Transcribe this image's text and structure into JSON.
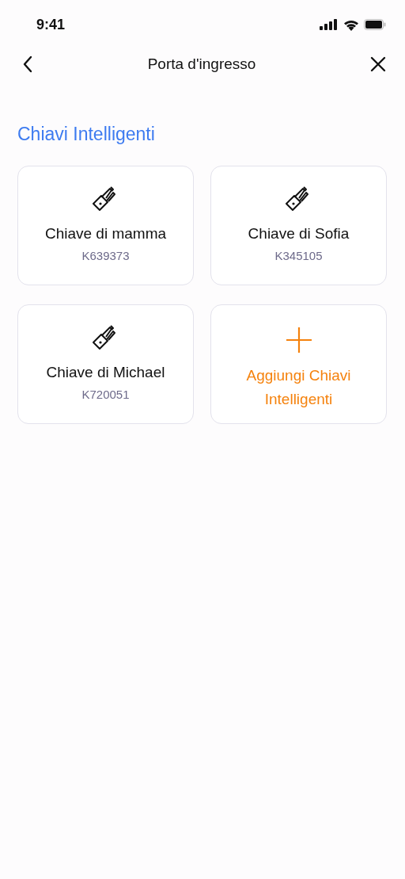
{
  "status_bar": {
    "time": "9:41"
  },
  "nav": {
    "title": "Porta d'ingresso"
  },
  "section": {
    "title": "Chiavi Intelligenti"
  },
  "cards": [
    {
      "kind": "key",
      "name": "Chiave di mamma",
      "code": "K639373"
    },
    {
      "kind": "key",
      "name": "Chiave di Sofia",
      "code": "K345105"
    },
    {
      "kind": "key",
      "name": "Chiave di Michael",
      "code": "K720051"
    },
    {
      "kind": "add",
      "label": "Aggiungi Chiavi Intelligenti"
    }
  ]
}
